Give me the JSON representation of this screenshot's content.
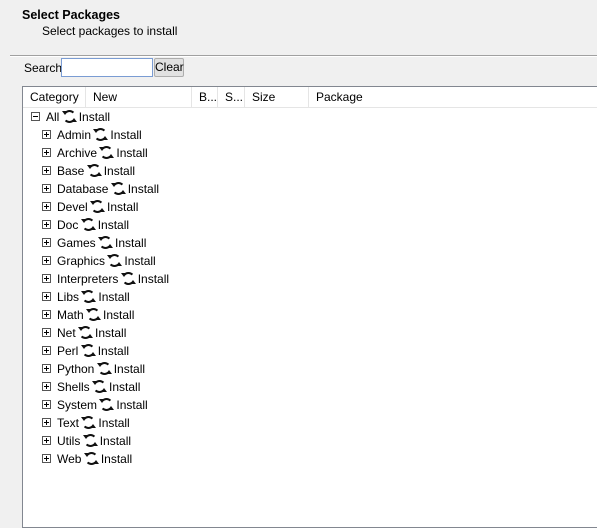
{
  "header": {
    "title": "Select Packages",
    "subtitle": "Select packages to install"
  },
  "search": {
    "label": "Search",
    "value": "",
    "placeholder": "",
    "clear_label": "Clear"
  },
  "columns": [
    "Category",
    "New",
    "B...",
    "S...",
    "Size",
    "Package"
  ],
  "tree": {
    "root": {
      "label": "All",
      "action": "Install",
      "expanded": true,
      "icon": "cycle-icon"
    },
    "categories": [
      {
        "label": "Admin",
        "action": "Install"
      },
      {
        "label": "Archive",
        "action": "Install"
      },
      {
        "label": "Base",
        "action": "Install"
      },
      {
        "label": "Database",
        "action": "Install"
      },
      {
        "label": "Devel",
        "action": "Install"
      },
      {
        "label": "Doc",
        "action": "Install"
      },
      {
        "label": "Games",
        "action": "Install"
      },
      {
        "label": "Graphics",
        "action": "Install"
      },
      {
        "label": "Interpreters",
        "action": "Install"
      },
      {
        "label": "Libs",
        "action": "Install"
      },
      {
        "label": "Math",
        "action": "Install"
      },
      {
        "label": "Net",
        "action": "Install"
      },
      {
        "label": "Perl",
        "action": "Install"
      },
      {
        "label": "Python",
        "action": "Install"
      },
      {
        "label": "Shells",
        "action": "Install"
      },
      {
        "label": "System",
        "action": "Install"
      },
      {
        "label": "Text",
        "action": "Install"
      },
      {
        "label": "Utils",
        "action": "Install"
      },
      {
        "label": "Web",
        "action": "Install"
      }
    ]
  }
}
